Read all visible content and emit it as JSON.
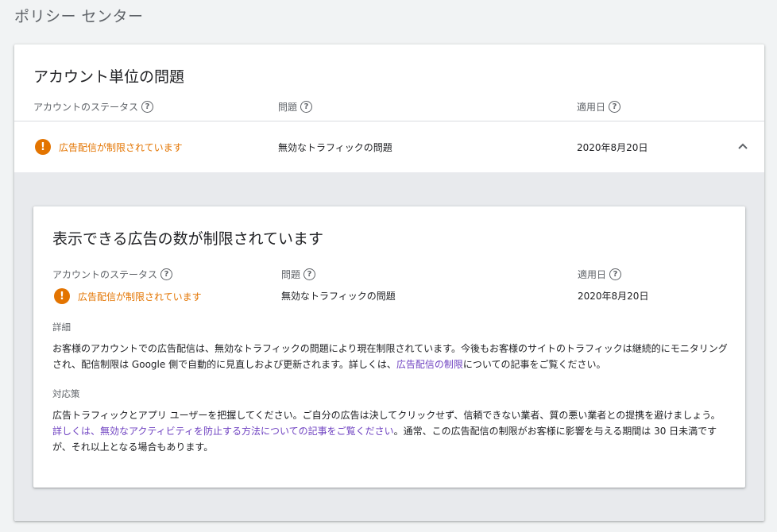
{
  "page": {
    "title": "ポリシー センター"
  },
  "card": {
    "title": "アカウント単位の問題",
    "columns": {
      "status": "アカウントのステータス",
      "issue": "問題",
      "applied_date": "適用日"
    },
    "help_glyph": "?",
    "row": {
      "status": "広告配信が制限されています",
      "issue": "無効なトラフィックの問題",
      "applied_date": "2020年8月20日",
      "expanded": true
    }
  },
  "detail": {
    "title": "表示できる広告の数が制限されています",
    "columns": {
      "status": "アカウントのステータス",
      "issue": "問題",
      "applied_date": "適用日"
    },
    "status": "広告配信が制限されています",
    "issue": "無効なトラフィックの問題",
    "applied_date": "2020年8月20日",
    "details_label": "詳細",
    "details_text_1": "お客様のアカウントでの広告配信は、無効なトラフィックの問題により現在制限されています。今後もお客様のサイトのトラフィックは継続的にモニタリングされ、配信制限は Google 側で自動的に見直しおよび更新されます。詳しくは、",
    "details_link": "広告配信の制限",
    "details_text_2": "についての記事をご覧ください。",
    "remedy_label": "対応策",
    "remedy_text_1": "広告トラフィックとアプリ ユーザーを把握してください。ご自分の広告は決してクリックせず、信頼できない業者、質の悪い業者との提携を避けましょう。",
    "remedy_link": "詳しくは、無効なアクティビティを防止する方法についての記事をご覧ください",
    "remedy_text_2": "。通常、この広告配信の制限がお客様に影響を与える期間は 30 日未満ですが、それ以上となる場合もあります。"
  },
  "icons": {
    "warning": "exclamation-circle",
    "help": "question-circle",
    "collapse": "chevron-up"
  },
  "colors": {
    "warning": "#e37400",
    "link": "#6f42c1",
    "secondary_text": "#5f6368"
  }
}
